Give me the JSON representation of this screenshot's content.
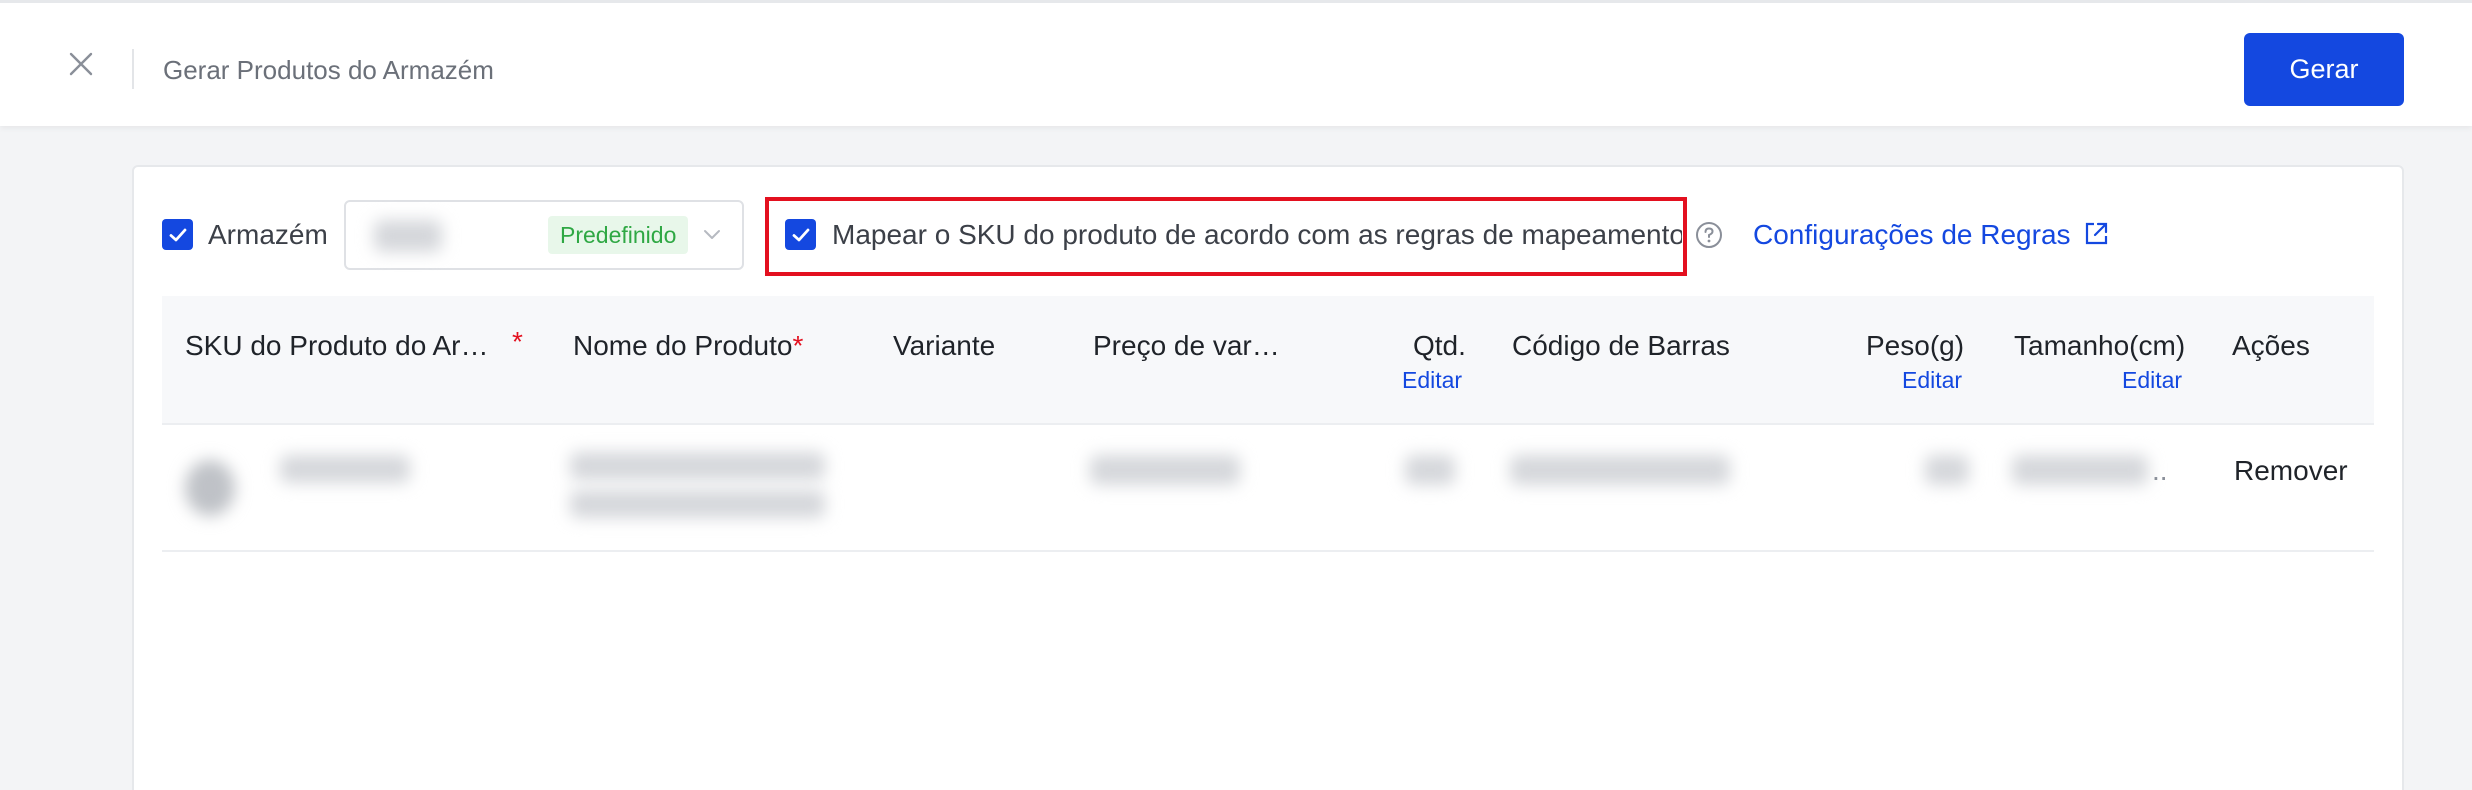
{
  "header": {
    "title": "Gerar Produtos do Armazém",
    "generate_label": "Gerar"
  },
  "options": {
    "warehouse_label": "Armazém",
    "warehouse_tag": "Predefinido",
    "map_sku_label": "Mapear o SKU do produto de acordo com as regras de mapeamento",
    "rules_link": "Configurações de Regras",
    "warehouse_checked": true,
    "map_sku_checked": true
  },
  "table": {
    "columns": [
      {
        "label": "SKU do Produto do Ar…",
        "required": true
      },
      {
        "label": "Nome do Produto",
        "required": true
      },
      {
        "label": "Variante",
        "required": false
      },
      {
        "label": "Preço de var…",
        "required": false
      },
      {
        "label": "Qtd.",
        "required": false,
        "edit": "Editar"
      },
      {
        "label": "Código de Barras",
        "required": false
      },
      {
        "label": "Peso(g)",
        "required": false,
        "edit": "Editar"
      },
      {
        "label": "Tamanho(cm)",
        "required": false,
        "edit": "Editar"
      },
      {
        "label": "Ações",
        "required": false
      }
    ],
    "required_mark": "*",
    "row_actions": {
      "remove": "Remover",
      "ellipsis": ".."
    }
  },
  "colors": {
    "primary": "#1448e0",
    "highlight": "#e3101f",
    "tag_bg": "#e8f7ea",
    "tag_text": "#2fa844"
  },
  "icons": {
    "close": "close-icon",
    "help": "help-circle-icon",
    "external": "external-link-icon",
    "chevron": "chevron-down-icon",
    "check": "check-icon"
  }
}
